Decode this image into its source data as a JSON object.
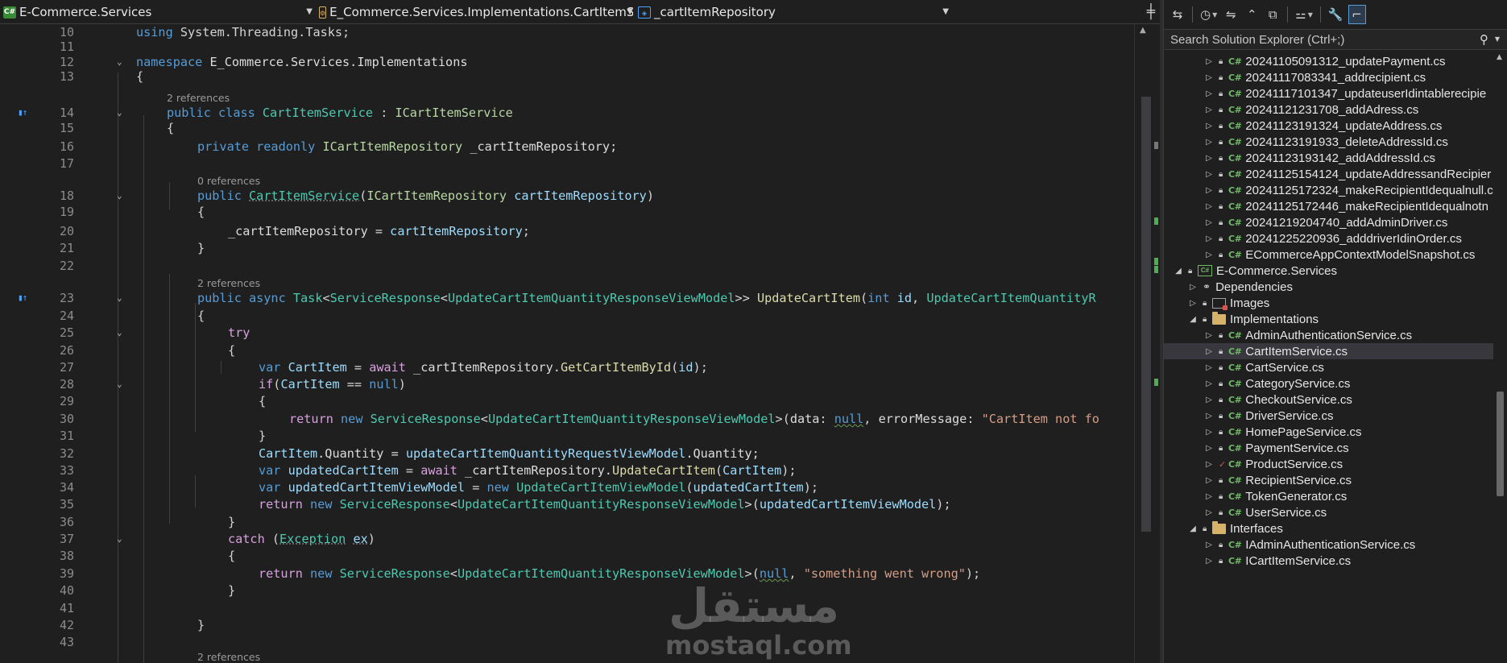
{
  "navbar": {
    "project": "E-Commerce.Services",
    "class": "E_Commerce.Services.Implementations.CartItemService",
    "member": "_cartItemRepository"
  },
  "editor": {
    "codelens": {
      "l14": "2 references",
      "l18": "0 references",
      "l23": "2 references",
      "l44": "2 references"
    },
    "line_numbers": [
      "10",
      "11",
      "12",
      "13",
      "14",
      "15",
      "16",
      "17",
      "18",
      "19",
      "20",
      "21",
      "22",
      "23",
      "24",
      "25",
      "26",
      "27",
      "28",
      "29",
      "30",
      "31",
      "32",
      "33",
      "34",
      "35",
      "36",
      "37",
      "38",
      "39",
      "40",
      "41",
      "42",
      "43"
    ],
    "code": {
      "l10": {
        "using": "using",
        "ns": "System.Threading.Tasks;"
      },
      "l12": {
        "kw": "namespace",
        "name": "E_Commerce.Services.Implementations"
      },
      "l13": "{",
      "l14": {
        "pub": "public",
        "cls": "class",
        "name": "CartItemService",
        "colon": " : ",
        "iface": "ICartItemService"
      },
      "l15": "{",
      "l16": {
        "mods": "private readonly",
        "type": "ICartItemRepository",
        "field": " _cartItemRepository;"
      },
      "l18": {
        "pub": "public",
        "ctor": "CartItemService",
        "open": "(",
        "type": "ICartItemRepository",
        "param": "cartItemRepository",
        "close": ")"
      },
      "l19": "{",
      "l20": {
        "field": "_cartItemRepository",
        "eq": " = ",
        "param": "cartItemRepository",
        "semi": ";"
      },
      "l21": "}",
      "l23": {
        "mods": "public async",
        "task": "Task",
        "lt": "<",
        "sr": "ServiceResponse",
        "lt2": "<",
        "vm": "UpdateCartItemQuantityResponseViewModel",
        "gt": ">> ",
        "method": "UpdateCartItem",
        "open": "(",
        "int": "int",
        "id": " id",
        "comma": ", ",
        "rest": "UpdateCartItemQuantityR"
      },
      "l24": "{",
      "l25": "try",
      "l26": "{",
      "l27": {
        "var": "var",
        "name": "CartItem",
        "eq": " = ",
        "await": "await",
        "repo": " _cartItemRepository.",
        "method": "GetCartItemById",
        "open": "(",
        "arg": "id",
        "close": ");"
      },
      "l28": {
        "if": "if",
        "open": "(",
        "name": "CartItem",
        "op": " == ",
        "null": "null",
        "close": ")"
      },
      "l29": "{",
      "l30": {
        "ret": "return",
        "new": "new",
        "sr": "ServiceResponse",
        "lt": "<",
        "vm": "UpdateCartItemQuantityResponseViewModel",
        "gt": ">(",
        "data": "data",
        "colon": ": ",
        "null": "null",
        "comma": ", ",
        "err": "errorMessage",
        "colon2": ": ",
        "str": "\"CartItem not fo"
      },
      "l31": "}",
      "l32": {
        "name": "CartItem",
        "prop": ".Quantity = ",
        "param": "updateCartItemQuantityRequestViewModel",
        "rest": ".Quantity;"
      },
      "l33": {
        "var": "var",
        "name": "updatedCartItem",
        "eq": " = ",
        "await": "await",
        "repo": " _cartItemRepository.",
        "method": "UpdateCartItem",
        "open": "(",
        "arg": "CartItem",
        "close": ");"
      },
      "l34": {
        "var": "var",
        "name": "updatedCartItemViewModel",
        "eq": " = ",
        "new": "new",
        "vm": "UpdateCartItemViewModel",
        "open": "(",
        "arg": "updatedCartItem",
        "close": ");"
      },
      "l35": {
        "ret": "return",
        "new": "new",
        "sr": "ServiceResponse",
        "lt": "<",
        "vm": "UpdateCartItemQuantityResponseViewModel",
        "gt": ">(",
        "arg": "updatedCartItemViewModel",
        "close": ");"
      },
      "l36": "}",
      "l37": {
        "catch": "catch",
        "open": " (",
        "ex": "Exception",
        "var": "ex",
        "close": ")"
      },
      "l38": "{",
      "l39": {
        "ret": "return",
        "new": "new",
        "sr": "ServiceResponse",
        "lt": "<",
        "vm": "UpdateCartItemQuantityResponseViewModel",
        "gt": ">(",
        "null": "null",
        "comma": ", ",
        "str": "\"something went wrong\"",
        "close": ");"
      },
      "l40": "}",
      "l42": "}"
    }
  },
  "solution_explorer": {
    "search_placeholder": "Search Solution Explorer (Ctrl+;)",
    "items": [
      {
        "label": "20241105091312_updatePayment.cs"
      },
      {
        "label": "20241117083341_addrecipient.cs"
      },
      {
        "label": "20241117101347_updateuserIdintablerecipie"
      },
      {
        "label": "20241121231708_addAdress.cs"
      },
      {
        "label": "20241123191324_updateAddress.cs"
      },
      {
        "label": "20241123191933_deleteAddressId.cs"
      },
      {
        "label": "20241123193142_addAddressId.cs"
      },
      {
        "label": "20241125154124_updateAddressandRecipier"
      },
      {
        "label": "20241125172324_makeRecipientIdequalnull.c"
      },
      {
        "label": "20241125172446_makeRecipientIdequalnotn"
      },
      {
        "label": "20241219204740_addAdminDriver.cs"
      },
      {
        "label": "20241225220936_adddriverIdinOrder.cs"
      },
      {
        "label": "ECommerceAppContextModelSnapshot.cs"
      },
      {
        "label": "E-Commerce.Services"
      },
      {
        "label": "Dependencies"
      },
      {
        "label": "Images"
      },
      {
        "label": "Implementations"
      },
      {
        "label": "AdminAuthenticationService.cs"
      },
      {
        "label": "CartItemService.cs"
      },
      {
        "label": "CartService.cs"
      },
      {
        "label": "CategoryService.cs"
      },
      {
        "label": "CheckoutService.cs"
      },
      {
        "label": "DriverService.cs"
      },
      {
        "label": "HomePageService.cs"
      },
      {
        "label": "PaymentService.cs"
      },
      {
        "label": "ProductService.cs"
      },
      {
        "label": "RecipientService.cs"
      },
      {
        "label": "TokenGenerator.cs"
      },
      {
        "label": "UserService.cs"
      },
      {
        "label": "Interfaces"
      },
      {
        "label": "IAdminAuthenticationService.cs"
      },
      {
        "label": "ICartItemService.cs"
      }
    ]
  },
  "watermark": {
    "arabic": "مستقل",
    "latin": "mostaql.com"
  },
  "colors": {
    "keyword": "#569cd6",
    "type": "#4ec9b0",
    "method": "#dcdcaa",
    "param": "#9cdcfe",
    "string": "#d69d85",
    "control": "#d8a0df"
  }
}
